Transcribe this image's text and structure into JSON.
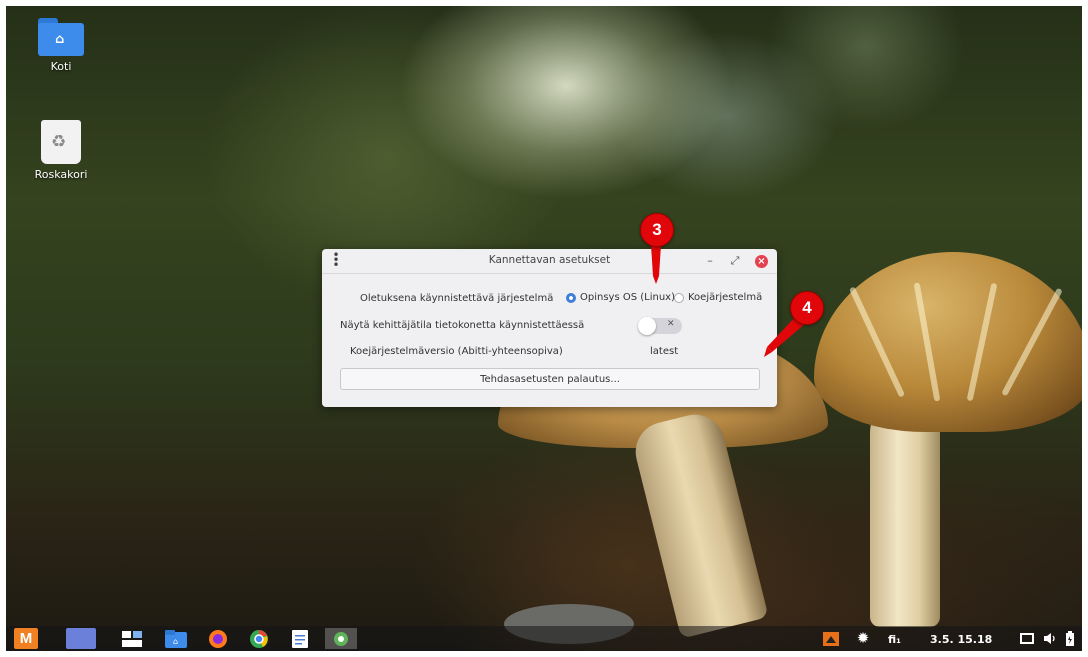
{
  "desktop": {
    "icons": [
      {
        "label": "Koti"
      },
      {
        "label": "Roskakori"
      }
    ]
  },
  "dialog": {
    "title": "Kannettavan asetukset",
    "default_os_label": "Oletuksena käynnistettävä järjestelmä",
    "option_opinsys": "Opinsys OS (Linux)",
    "option_exam": "Koejärjestelmä",
    "selected_option": "Opinsys OS (Linux)",
    "dev_mode_label": "Näytä kehittäjätila tietokonetta käynnistettäessä",
    "dev_mode_enabled": false,
    "exam_version_label": "Koejärjestelmäversio (Abitti-yhteensopiva)",
    "exam_version_value": "latest",
    "reset_button": "Tehdasasetusten palautus..."
  },
  "callouts": [
    "3",
    "4"
  ],
  "taskbar": {
    "keyboard_layout": "fi₁",
    "datetime": "3.5. 15.18"
  },
  "colors": {
    "accent": "#3d7fd9",
    "close": "#e5414e",
    "callout": "#e1060a"
  }
}
